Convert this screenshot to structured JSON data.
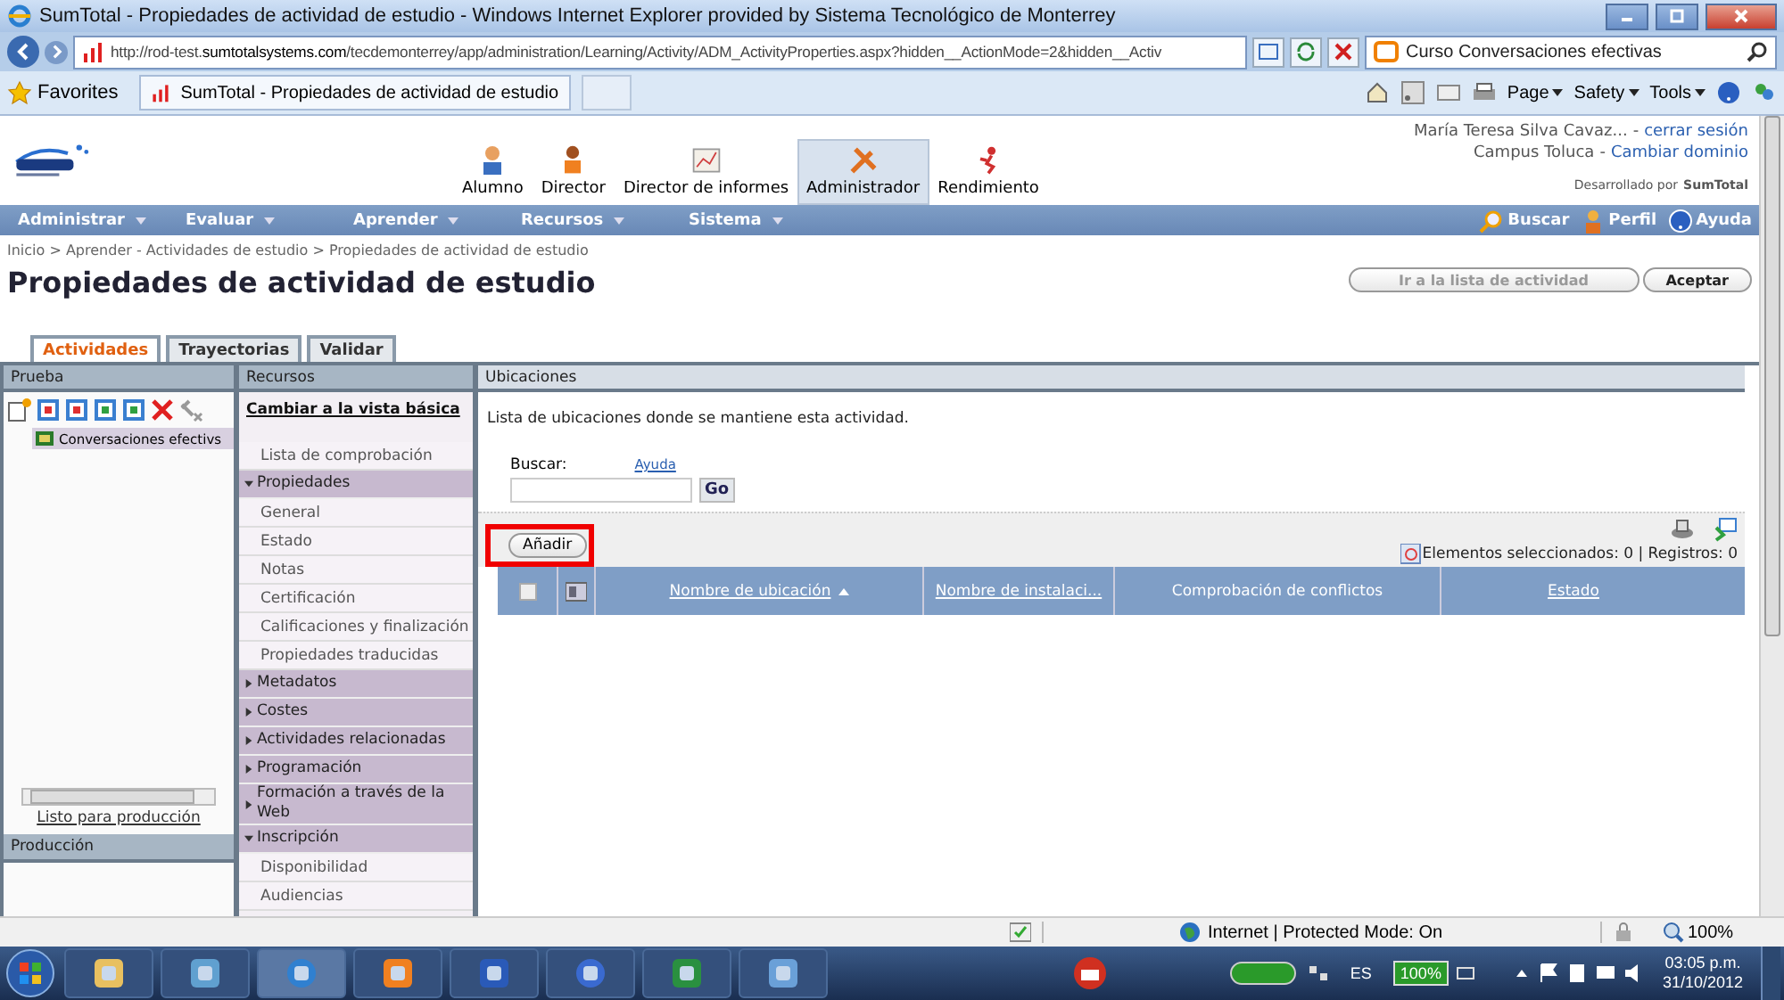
{
  "window": {
    "title": "SumTotal - Propiedades de actividad de estudio - Windows Internet Explorer provided by Sistema Tecnológico de Monterrey"
  },
  "browser": {
    "address_prefix": "http://rod-test.",
    "address_domain": "sumtotalsystems.com",
    "address_rest": "/tecdemonterrey/app/administration/Learning/Activity/ADM_ActivityProperties.aspx?hidden__ActionMode=2&hidden__Activ",
    "search_value": "Curso Conversaciones efectivas",
    "favorites": "Favorites",
    "tab_title": "SumTotal - Propiedades de actividad de estudio",
    "commands": [
      "Page",
      "Safety",
      "Tools"
    ]
  },
  "header": {
    "user": "María Teresa Silva Cavaz...",
    "user_separator": "-",
    "logout": "cerrar sesión",
    "campus": "Campus Toluca",
    "campus_separator": "-",
    "change_domain": "Cambiar dominio",
    "powered_by": "Desarrollado por",
    "powered_brand": "SumTotal",
    "nav_items": [
      {
        "label": "Alumno",
        "selected": false
      },
      {
        "label": "Director",
        "selected": false
      },
      {
        "label": "Director de informes",
        "selected": false
      },
      {
        "label": "Administrador",
        "selected": true
      },
      {
        "label": "Rendimiento",
        "selected": false
      }
    ]
  },
  "menu": {
    "items": [
      "Administrar",
      "Evaluar",
      "Aprender",
      "Recursos",
      "Sistema"
    ],
    "search": "Buscar",
    "profile": "Perfil",
    "help": "Ayuda"
  },
  "breadcrumb": "Inicio > Aprender - Actividades de estudio > Propiedades de actividad de estudio",
  "page_title": "Propiedades de actividad de estudio",
  "actions": [
    {
      "label": "Ir a la lista de actividad",
      "disabled": true
    },
    {
      "label": "Aceptar",
      "disabled": false
    }
  ],
  "tabs": [
    {
      "label": "Actividades",
      "selected": true
    },
    {
      "label": "Trayectorias",
      "selected": false
    },
    {
      "label": "Validar",
      "selected": false
    }
  ],
  "tree_panel": {
    "title": "Prueba",
    "items": [
      {
        "label": "Conversaciones efectivs",
        "selected": true
      }
    ],
    "ready_link": "Listo para producción",
    "production_title": "Producción"
  },
  "resources": {
    "title": "Recursos",
    "basic_view": "Cambiar a la vista básica",
    "items": [
      {
        "label": "Lista de comprobación"
      },
      {
        "label": "Propiedades",
        "expanded": true,
        "children": [
          {
            "label": "General"
          },
          {
            "label": "Estado"
          },
          {
            "label": "Notas"
          },
          {
            "label": "Certificación"
          },
          {
            "label": "Calificaciones y finalización"
          },
          {
            "label": "Propiedades traducidas"
          }
        ]
      },
      {
        "label": "Metadatos",
        "expanded": false
      },
      {
        "label": "Costes",
        "expanded": false
      },
      {
        "label": "Actividades relacionadas",
        "expanded": false
      },
      {
        "label": "Programación",
        "expanded": false
      },
      {
        "label": "Formación a través de la Web",
        "expanded": false
      },
      {
        "label": "Inscripción",
        "expanded": true,
        "children": [
          {
            "label": "Disponibilidad"
          },
          {
            "label": "Audiencias"
          }
        ]
      }
    ]
  },
  "locations": {
    "title": "Ubicaciones",
    "description": "Lista de ubicaciones donde se mantiene esta actividad.",
    "search_label": "Buscar:",
    "help": "Ayuda",
    "go": "Go",
    "add_button": {
      "label": "Añadir",
      "highlighted": true
    },
    "summary": "Elementos seleccionados: 0 | Registros: 0",
    "select_all_checked": false,
    "columns": [
      {
        "label": "Nombre de ubicación",
        "sortable": true,
        "sorted": true
      },
      {
        "label": "Nombre de instalaci...",
        "sortable": true,
        "sorted": false
      },
      {
        "label": "Comprobación de conflictos",
        "sortable": false,
        "sorted": false
      },
      {
        "label": "Estado",
        "sortable": true,
        "sorted": false
      }
    ]
  },
  "status_bar": {
    "zone": "Internet | Protected Mode: On",
    "zoom": "100%"
  },
  "taskbar": {
    "language": "ES",
    "battery": "100%",
    "time": "03:05 p.m.",
    "date": "31/10/2012"
  }
}
